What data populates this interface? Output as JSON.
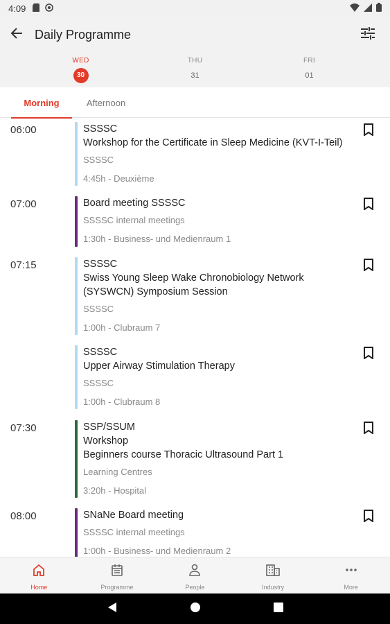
{
  "status_bar": {
    "time": "4:09",
    "icons_left": [
      "sd-card-icon",
      "sync-icon"
    ],
    "icons_right": [
      "wifi-icon",
      "signal-icon",
      "battery-icon"
    ]
  },
  "app_bar": {
    "title": "Daily Programme",
    "back_icon": "arrow-back-icon",
    "filter_icon": "tune-icon"
  },
  "days": [
    {
      "dow": "WED",
      "num": "30",
      "active": true
    },
    {
      "dow": "THU",
      "num": "31",
      "active": false
    },
    {
      "dow": "FRI",
      "num": "01",
      "active": false
    }
  ],
  "tabs": [
    {
      "label": "Morning",
      "active": true
    },
    {
      "label": "Afternoon",
      "active": false
    }
  ],
  "colors": {
    "accent": "#e23b2a",
    "track_light_blue": "#b3d9f2",
    "track_purple": "#6b2a7e",
    "track_green": "#2d6a3a"
  },
  "sessions": [
    {
      "time": "06:00",
      "color": "#b3d9f2",
      "lines": [
        "SSSSC",
        "Workshop for the Certificate in Sleep Medicine  (KVT-I-Teil)"
      ],
      "meta": "SSSSC",
      "location": "4:45h - Deuxième"
    },
    {
      "time": "07:00",
      "color": "#6b2a7e",
      "lines": [
        "Board meeting SSSSC"
      ],
      "meta": "SSSSC internal meetings",
      "location": "1:30h - Business- und Medienraum 1"
    },
    {
      "time": "07:15",
      "color": "#b3d9f2",
      "lines": [
        "SSSSC",
        "Swiss Young Sleep Wake Chronobiology Network",
        "(SYSWCN) Symposium Session"
      ],
      "meta": "SSSSC",
      "location": "1:00h - Clubraum 7"
    },
    {
      "time": "",
      "color": "#b3d9f2",
      "lines": [
        "SSSSC",
        "Upper Airway Stimulation Therapy"
      ],
      "meta": "SSSSC",
      "location": "1:00h - Clubraum 8"
    },
    {
      "time": "07:30",
      "color": "#2d6a3a",
      "lines": [
        "SSP/SSUM",
        "Workshop",
        "Beginners course Thoracic Ultrasound Part 1"
      ],
      "meta": "Learning Centres",
      "location": "3:20h - Hospital"
    },
    {
      "time": "08:00",
      "color": "#6b2a7e",
      "lines": [
        "SNaNe Board meeting"
      ],
      "meta": "SSSSC internal meetings",
      "location": "1:00h - Business- und Medienraum 2"
    }
  ],
  "bottom_nav": [
    {
      "label": "Home",
      "icon": "home-icon",
      "active": true
    },
    {
      "label": "Programme",
      "icon": "calendar-icon",
      "active": false
    },
    {
      "label": "People",
      "icon": "person-icon",
      "active": false
    },
    {
      "label": "Industry",
      "icon": "building-icon",
      "active": false
    },
    {
      "label": "More",
      "icon": "more-icon",
      "active": false
    }
  ]
}
